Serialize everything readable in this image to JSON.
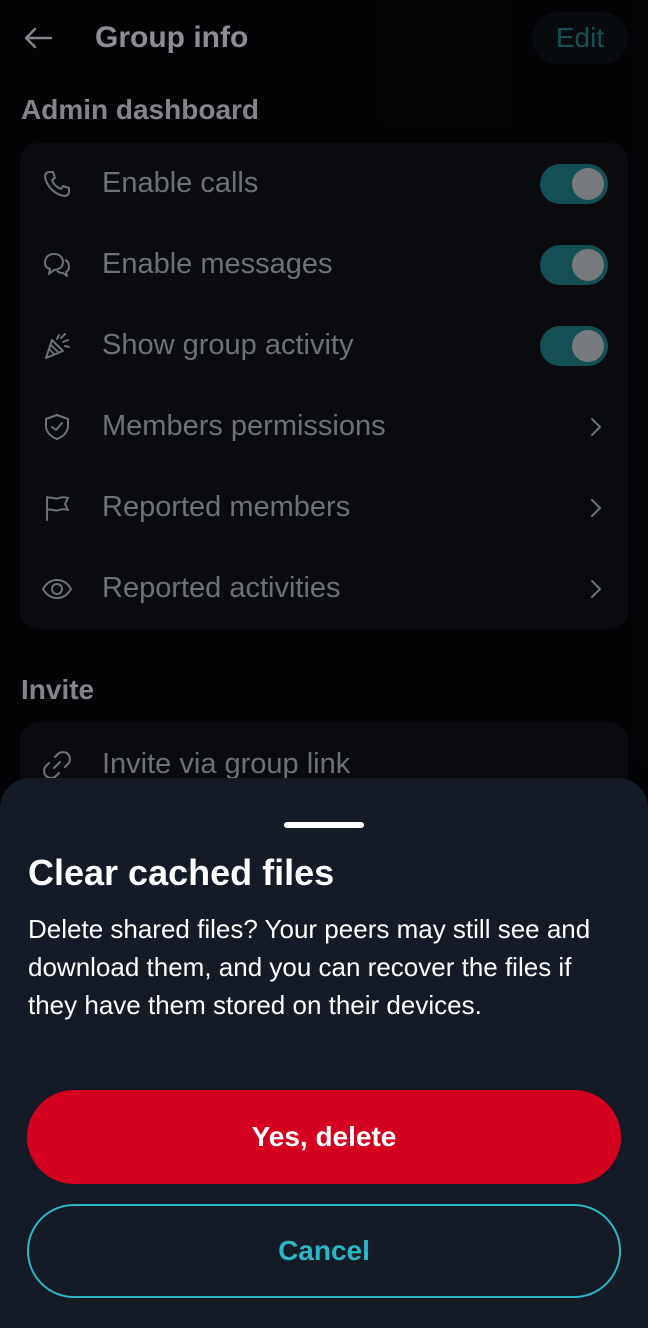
{
  "header": {
    "title": "Group info",
    "edit_label": "Edit"
  },
  "admin_dashboard": {
    "title": "Admin dashboard",
    "items": [
      {
        "label": "Enable calls",
        "icon": "phone-icon",
        "control": "toggle",
        "on": true
      },
      {
        "label": "Enable messages",
        "icon": "chat-icon",
        "control": "toggle",
        "on": true
      },
      {
        "label": "Show group activity",
        "icon": "party-popper-icon",
        "control": "toggle",
        "on": true
      },
      {
        "label": "Members permissions",
        "icon": "shield-check-icon",
        "control": "chevron"
      },
      {
        "label": "Reported members",
        "icon": "flag-icon",
        "control": "chevron"
      },
      {
        "label": "Reported activities",
        "icon": "eye-icon",
        "control": "chevron"
      }
    ]
  },
  "invite": {
    "title": "Invite",
    "items": [
      {
        "label": "Invite via group link",
        "icon": "link-icon"
      }
    ]
  },
  "dialog": {
    "title": "Clear cached files",
    "body": "Delete shared files? Your peers may still see and download them, and you can recover the files if they have them stored on their devices.",
    "confirm_label": "Yes, delete",
    "cancel_label": "Cancel"
  },
  "colors": {
    "accent_teal": "#2ab7c5",
    "danger_red": "#d3001f",
    "sheet_bg": "#141b27"
  }
}
